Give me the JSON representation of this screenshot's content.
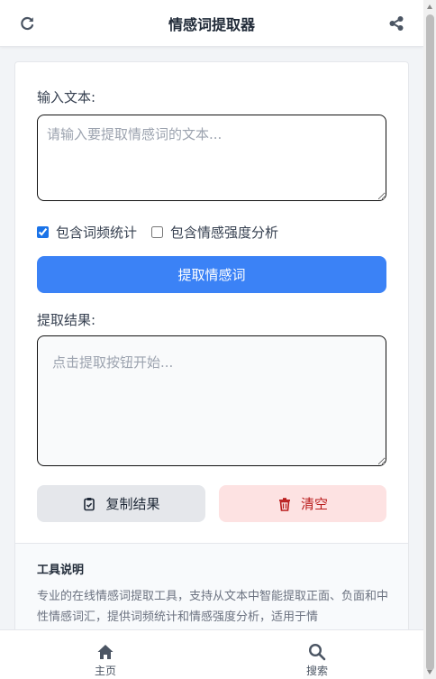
{
  "header": {
    "title": "情感词提取器",
    "refresh_icon": "refresh-icon",
    "share_icon": "share-icon"
  },
  "input": {
    "label": "输入文本:",
    "placeholder": "请输入要提取情感词的文本...",
    "value": ""
  },
  "options": {
    "word_freq": {
      "label": "包含词频统计",
      "checked": true
    },
    "intensity": {
      "label": "包含情感强度分析",
      "checked": false
    }
  },
  "extract_button": {
    "label": "提取情感词"
  },
  "result": {
    "label": "提取结果:",
    "placeholder": "点击提取按钮开始...",
    "value": ""
  },
  "actions": {
    "copy": {
      "label": "复制结果",
      "icon": "clipboard-icon"
    },
    "clear": {
      "label": "清空",
      "icon": "trash-icon"
    }
  },
  "info": {
    "title": "工具说明",
    "text": "专业的在线情感词提取工具，支持从文本中智能提取正面、负面和中性情感词汇，提供词频统计和情感强度分析，适用于情"
  },
  "nav": {
    "home": {
      "label": "主页",
      "icon": "home-icon"
    },
    "search": {
      "label": "搜索",
      "icon": "search-icon"
    }
  },
  "colors": {
    "primary": "#3b82f6",
    "danger_bg": "#fde2e2",
    "danger_text": "#b91c1c",
    "nav_icon": "#4b5563"
  }
}
